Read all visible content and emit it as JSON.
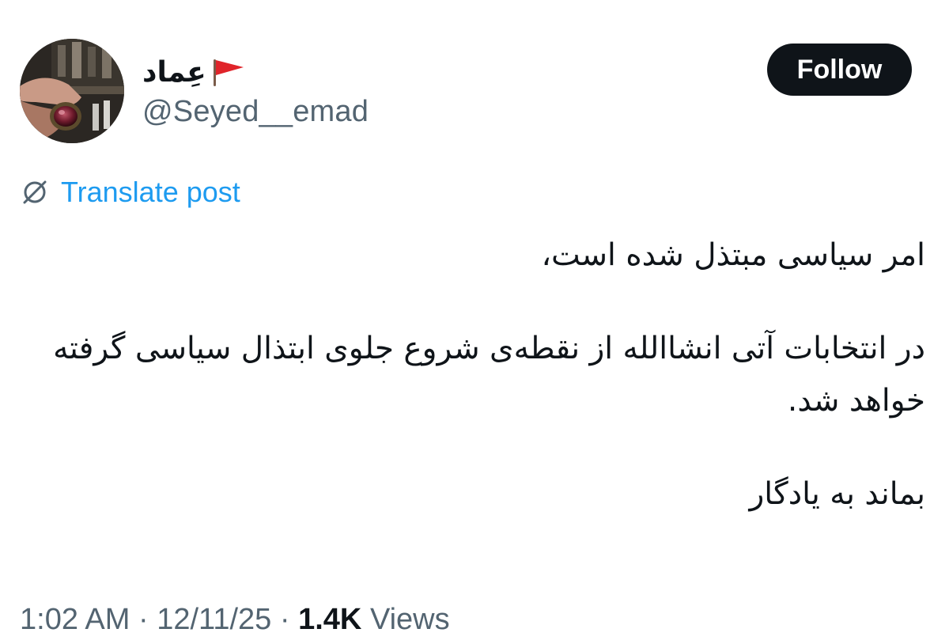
{
  "author": {
    "display_name": "عِماد",
    "flag_icon": "red-flag-icon",
    "handle": "@Seyed__emad"
  },
  "follow_button": {
    "label": "Follow"
  },
  "translate": {
    "icon": "translate-globe-icon",
    "label": "Translate post"
  },
  "post": {
    "paragraphs": [
      "امر سیاسی مبتذل شده است،",
      "در انتخابات آتی انشاالله از نقطه‌ی شروع جلوی ابتذال سیاسی گرفته خواهد شد.",
      "بماند به یادگار"
    ]
  },
  "meta": {
    "time": "1:02 AM",
    "separator": "·",
    "date": "12/11/25",
    "views_count": "1.4K",
    "views_label": "Views"
  },
  "colors": {
    "follow_bg": "#0f1419",
    "link": "#1d9bf0",
    "secondary_text": "#536471",
    "flag": "#e0242a"
  }
}
